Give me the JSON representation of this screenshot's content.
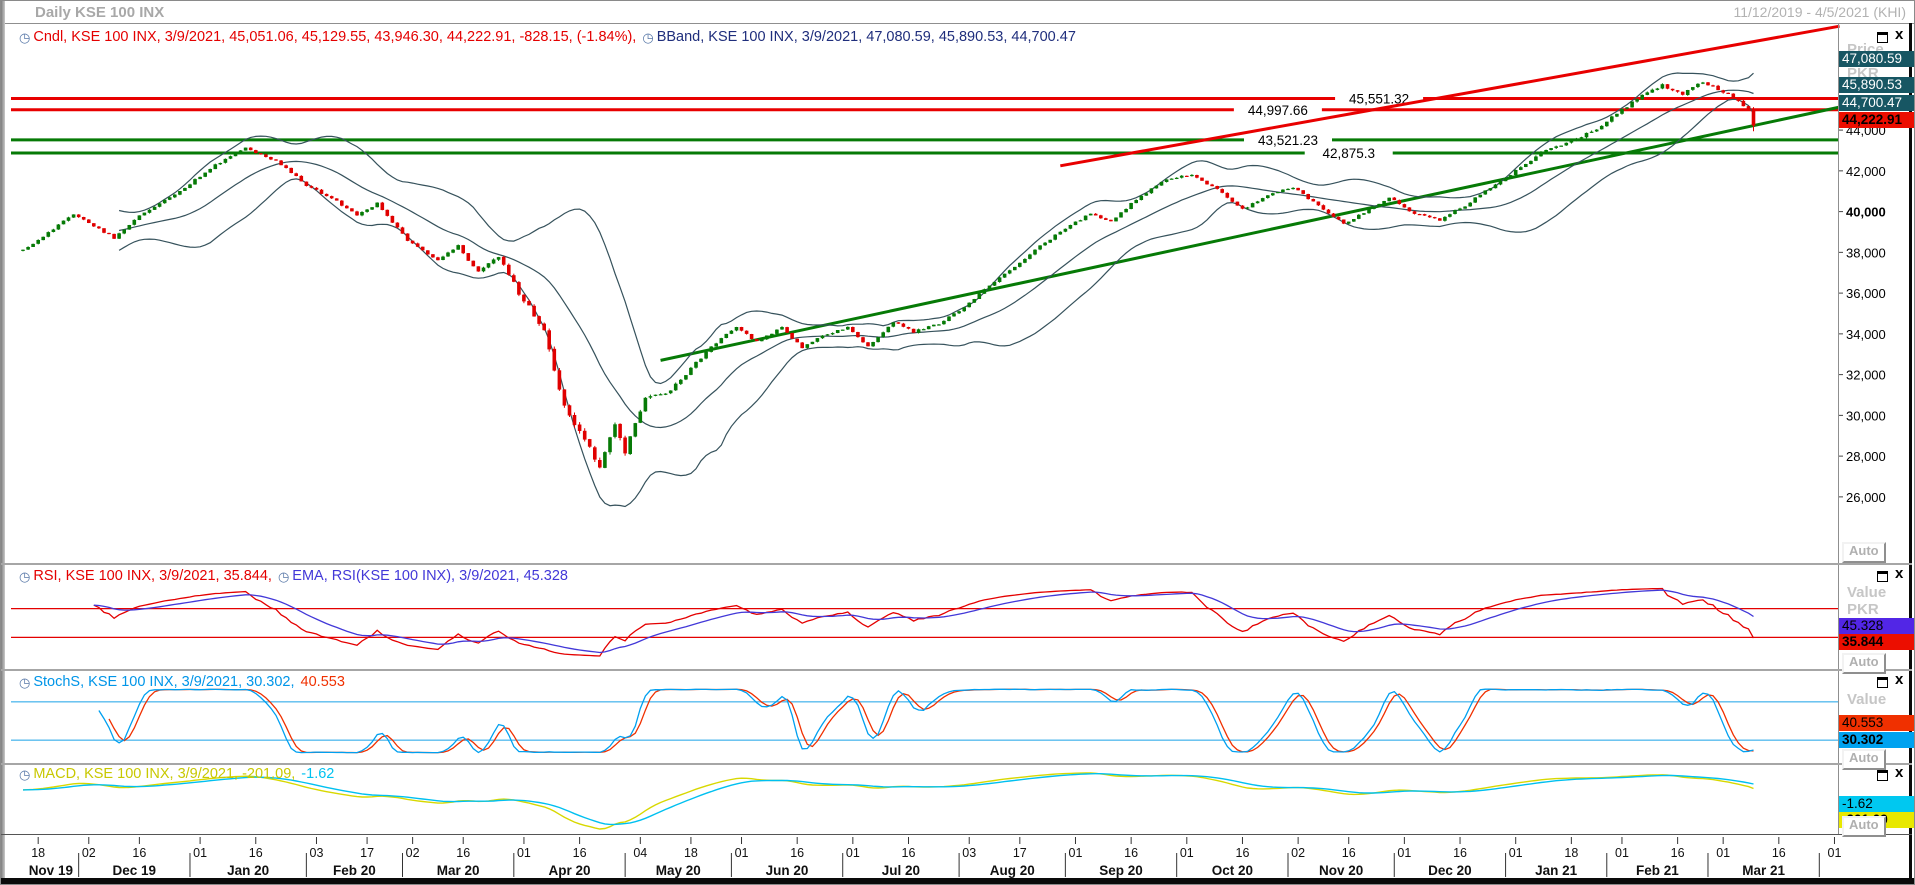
{
  "window": {
    "title": "Daily KSE 100 INX",
    "date_range": "11/12/2019 - 4/5/2021 (KHI)"
  },
  "panels": {
    "main": {
      "legends": [
        {
          "icon": true,
          "text": "Cndl, KSE 100 INX, 3/9/2021, 45,051.06, 45,129.55, 43,946.30, 44,222.91, -828.15, (-1.84%),",
          "color": "#e40000"
        },
        {
          "icon": true,
          "text": "BBand, KSE 100 INX, 3/9/2021, 47,080.59, 45,890.53, 44,700.47",
          "color": "#1f2e7c"
        }
      ],
      "axis_label": "Price",
      "currency_label": "PKR",
      "auto_label": "Auto",
      "price_boxes": [
        {
          "value": "47,080.59",
          "bg": "#175663",
          "fg": "#ffffff",
          "bold": false
        },
        {
          "value": "45,890.53",
          "bg": "#175663",
          "fg": "#ffffff",
          "bold": false
        },
        {
          "value": "44,700.47",
          "bg": "#175663",
          "fg": "#ffffff",
          "bold": false
        },
        {
          "value": "44,222.91",
          "bg": "#ec0e00",
          "fg": "#000000",
          "bold": true
        }
      ],
      "y_ticks": [
        {
          "label": "44,000",
          "value": 44000,
          "bold": false
        },
        {
          "label": "42,000",
          "value": 42000,
          "bold": false
        },
        {
          "label": "40,000",
          "value": 40000,
          "bold": true
        },
        {
          "label": "38,000",
          "value": 38000,
          "bold": false
        },
        {
          "label": "36,000",
          "value": 36000,
          "bold": false
        },
        {
          "label": "34,000",
          "value": 34000,
          "bold": false
        },
        {
          "label": "32,000",
          "value": 32000,
          "bold": false
        },
        {
          "label": "30,000",
          "value": 30000,
          "bold": false
        },
        {
          "label": "28,000",
          "value": 28000,
          "bold": false
        },
        {
          "label": "26,000",
          "value": 26000,
          "bold": false
        }
      ]
    },
    "rsi": {
      "legends": [
        {
          "icon": true,
          "text": "RSI, KSE 100 INX, 3/9/2021, 35.844,",
          "color": "#e40000"
        },
        {
          "icon": true,
          "text": "EMA, RSI(KSE 100 INX), 3/9/2021, 45.328",
          "color": "#4238d8"
        }
      ],
      "axis_label": "Value",
      "currency_label": "PKR",
      "auto_label": "Auto",
      "value_boxes": [
        {
          "value": "45.328",
          "bg": "#5226e6",
          "fg": "#000000",
          "bold": false
        },
        {
          "value": "35.844",
          "bg": "#ec0e00",
          "fg": "#000000",
          "bold": true
        }
      ],
      "levels": [
        70,
        30
      ],
      "level_color": "#e40000"
    },
    "stoch": {
      "legends": [
        {
          "icon": true,
          "text": "StochS, KSE 100 INX, 3/9/2021, 30.302,",
          "color": "#0095e8"
        },
        {
          "icon": false,
          "text": "40.553",
          "color": "#f03000"
        }
      ],
      "axis_label": "Value",
      "auto_label": "Auto",
      "value_boxes": [
        {
          "value": "40.553",
          "bg": "#f03000",
          "fg": "#000000",
          "bold": false
        },
        {
          "value": "30.302",
          "bg": "#00a2f0",
          "fg": "#000000",
          "bold": true
        }
      ],
      "levels": [
        80,
        20
      ],
      "level_color": "#58bbee"
    },
    "macd": {
      "legends": [
        {
          "icon": true,
          "text": "MACD, KSE 100 INX, 3/9/2021, -201.09,",
          "color": "#c8c800"
        },
        {
          "icon": false,
          "text": "-1.62",
          "color": "#00c2f0"
        }
      ],
      "auto_label": "Auto",
      "value_boxes": [
        {
          "value": "-1.62",
          "bg": "#00c8f0",
          "fg": "#000000",
          "bold": false
        },
        {
          "value": "-201.09",
          "bg": "#e8e800",
          "fg": "#000000",
          "bold": true
        }
      ]
    }
  },
  "x_axis": {
    "days": [
      [
        "18",
        3
      ],
      [
        "02",
        13
      ],
      [
        "16",
        23
      ],
      [
        "01",
        35
      ],
      [
        "16",
        46
      ],
      [
        "03",
        58
      ],
      [
        "17",
        68
      ],
      [
        "02",
        77
      ],
      [
        "16",
        87
      ],
      [
        "01",
        99
      ],
      [
        "16",
        110
      ],
      [
        "04",
        122
      ],
      [
        "18",
        132
      ],
      [
        "01",
        142
      ],
      [
        "16",
        153
      ],
      [
        "01",
        164
      ],
      [
        "16",
        175
      ],
      [
        "03",
        187
      ],
      [
        "17",
        197
      ],
      [
        "01",
        208
      ],
      [
        "16",
        219
      ],
      [
        "01",
        230
      ],
      [
        "16",
        241
      ],
      [
        "02",
        252
      ],
      [
        "16",
        262
      ],
      [
        "01",
        273
      ],
      [
        "16",
        284
      ],
      [
        "01",
        295
      ],
      [
        "18",
        306
      ],
      [
        "01",
        316
      ],
      [
        "16",
        327
      ],
      [
        "01",
        336
      ],
      [
        "16",
        347
      ],
      [
        "01",
        358
      ]
    ],
    "months": [
      [
        "Nov 19",
        0,
        11
      ],
      [
        "Dec 19",
        11,
        33
      ],
      [
        "Jan 20",
        33,
        56
      ],
      [
        "Feb 20",
        56,
        75
      ],
      [
        "Mar 20",
        75,
        97
      ],
      [
        "Apr 20",
        97,
        119
      ],
      [
        "May 20",
        119,
        140
      ],
      [
        "Jun 20",
        140,
        162
      ],
      [
        "Jul 20",
        162,
        185
      ],
      [
        "Aug 20",
        185,
        206
      ],
      [
        "Sep 20",
        206,
        228
      ],
      [
        "Oct 20",
        228,
        250
      ],
      [
        "Nov 20",
        250,
        271
      ],
      [
        "Dec 20",
        271,
        293
      ],
      [
        "Jan 21",
        293,
        313
      ],
      [
        "Feb 21",
        313,
        333
      ],
      [
        "Mar 21",
        333,
        355
      ]
    ]
  },
  "chart_data": {
    "type": "candlestick",
    "symbol": "KSE 100 INX",
    "timeframe": "Daily",
    "visible_range": "11/12/2019 - 4/5/2021",
    "last_bar": {
      "date": "3/9/2021",
      "open": 45051.06,
      "high": 45129.55,
      "low": 43946.3,
      "close": 44222.91,
      "change": -828.15,
      "change_pct": "-1.84%"
    },
    "indicators": {
      "bollinger": {
        "upper": 47080.59,
        "middle": 45890.53,
        "lower": 44700.47,
        "period": 20
      },
      "rsi": {
        "value": 35.844,
        "ema_of_rsi": 45.328
      },
      "stochastic_slow": {
        "k": 30.302,
        "d": 40.553
      },
      "macd": {
        "macd": -201.09,
        "signal": -1.62
      }
    },
    "hlines": [
      {
        "price": 45551.32,
        "label": "45,551.32",
        "color": "#e80000",
        "label_t": 268
      },
      {
        "price": 44997.66,
        "label": "44,997.66",
        "color": "#e80000",
        "label_t": 248
      },
      {
        "price": 43521.23,
        "label": "43,521.23",
        "color": "#067a06",
        "label_t": 250
      },
      {
        "price": 42875.3,
        "label": "42,875.3",
        "color": "#067a06",
        "label_t": 262
      }
    ],
    "trendlines": [
      {
        "t1": 205,
        "p1": 42250,
        "t2": 359,
        "p2": 49100,
        "color": "#e80000"
      },
      {
        "t1": 126,
        "p1": 32700,
        "t2": 359,
        "p2": 45130,
        "color": "#067a06"
      }
    ],
    "bars": 343,
    "ylim": [
      23000,
      49060
    ],
    "close_keyframes": [
      [
        0,
        38100
      ],
      [
        3,
        38600
      ],
      [
        10,
        39900
      ],
      [
        14,
        39300
      ],
      [
        18,
        38700
      ],
      [
        24,
        40000
      ],
      [
        30,
        40800
      ],
      [
        38,
        42300
      ],
      [
        44,
        43100
      ],
      [
        50,
        42500
      ],
      [
        56,
        41300
      ],
      [
        62,
        40500
      ],
      [
        66,
        39800
      ],
      [
        70,
        40400
      ],
      [
        76,
        38600
      ],
      [
        82,
        37600
      ],
      [
        86,
        38300
      ],
      [
        90,
        37000
      ],
      [
        94,
        37800
      ],
      [
        98,
        36000
      ],
      [
        103,
        34200
      ],
      [
        107,
        30500
      ],
      [
        111,
        28800
      ],
      [
        114,
        27400
      ],
      [
        117,
        29500
      ],
      [
        119,
        28200
      ],
      [
        123,
        30800
      ],
      [
        128,
        31200
      ],
      [
        133,
        32600
      ],
      [
        138,
        33800
      ],
      [
        141,
        34300
      ],
      [
        145,
        33600
      ],
      [
        150,
        34300
      ],
      [
        154,
        33300
      ],
      [
        158,
        33900
      ],
      [
        163,
        34300
      ],
      [
        167,
        33400
      ],
      [
        172,
        34600
      ],
      [
        176,
        34100
      ],
      [
        181,
        34500
      ],
      [
        186,
        35300
      ],
      [
        191,
        36400
      ],
      [
        196,
        37300
      ],
      [
        201,
        38300
      ],
      [
        206,
        39200
      ],
      [
        211,
        39900
      ],
      [
        215,
        39500
      ],
      [
        220,
        40600
      ],
      [
        226,
        41600
      ],
      [
        231,
        41800
      ],
      [
        236,
        41100
      ],
      [
        241,
        40100
      ],
      [
        246,
        40800
      ],
      [
        251,
        41200
      ],
      [
        256,
        40300
      ],
      [
        261,
        39400
      ],
      [
        266,
        40100
      ],
      [
        270,
        40700
      ],
      [
        275,
        39900
      ],
      [
        280,
        39600
      ],
      [
        285,
        40300
      ],
      [
        290,
        41200
      ],
      [
        295,
        42000
      ],
      [
        300,
        42900
      ],
      [
        305,
        43400
      ],
      [
        310,
        43900
      ],
      [
        315,
        44800
      ],
      [
        320,
        45700
      ],
      [
        324,
        46200
      ],
      [
        328,
        45800
      ],
      [
        332,
        46400
      ],
      [
        335,
        46000
      ],
      [
        338,
        45600
      ],
      [
        341,
        45051.06
      ],
      [
        342,
        44222.91
      ]
    ],
    "colors": {
      "candle_up": "#067a06",
      "candle_down": "#e00000",
      "bollinger": "#36525c",
      "rsi": "#e40000",
      "rsi_ema": "#4238d8",
      "stoch_k": "#00a0f0",
      "stoch_d": "#f03000",
      "macd": "#d8d800",
      "macd_signal": "#00c0f0"
    }
  }
}
